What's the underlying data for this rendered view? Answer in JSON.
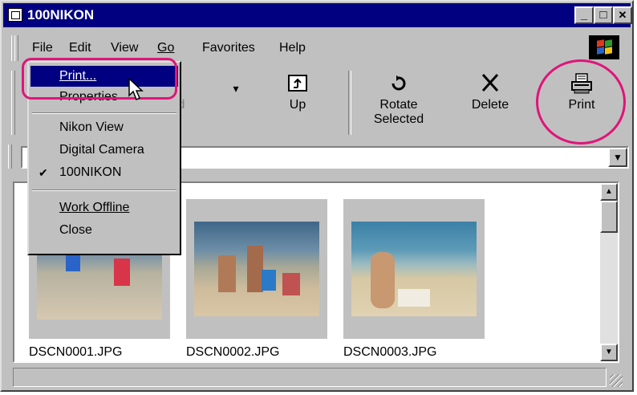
{
  "window": {
    "title": "100NIKON"
  },
  "titlebar": {
    "min": "_",
    "max": "□",
    "close": "✕"
  },
  "menubar": {
    "items": [
      "File",
      "Edit",
      "View",
      "Go",
      "Favorites",
      "Help"
    ]
  },
  "toolbar": {
    "forward_label": "ward",
    "up_label": "Up",
    "rotate_label": "Rotate\nSelected",
    "delete_label": "Delete",
    "print_label": "Print",
    "dropdown_arrow": "▾"
  },
  "file_menu": {
    "items": [
      {
        "label": "Print...",
        "active": true
      },
      {
        "label": "Properties"
      },
      {
        "label": "Nikon View"
      },
      {
        "label": "Digital Camera"
      },
      {
        "label": "100NIKON",
        "checked": true
      },
      {
        "label": "Work Offline"
      },
      {
        "label": "Close"
      }
    ],
    "check_mark": "✔"
  },
  "files": [
    {
      "name": "DSCN0001.JPG"
    },
    {
      "name": "DSCN0002.JPG"
    },
    {
      "name": "DSCN0003.JPG"
    }
  ],
  "icons": {
    "up": "up-folder-icon",
    "rotate": "rotate-icon",
    "delete": "delete-icon",
    "print": "printer-icon"
  },
  "colors": {
    "title_bar": "#000080",
    "highlight": "#e0147a",
    "face": "#c0c0c0"
  }
}
